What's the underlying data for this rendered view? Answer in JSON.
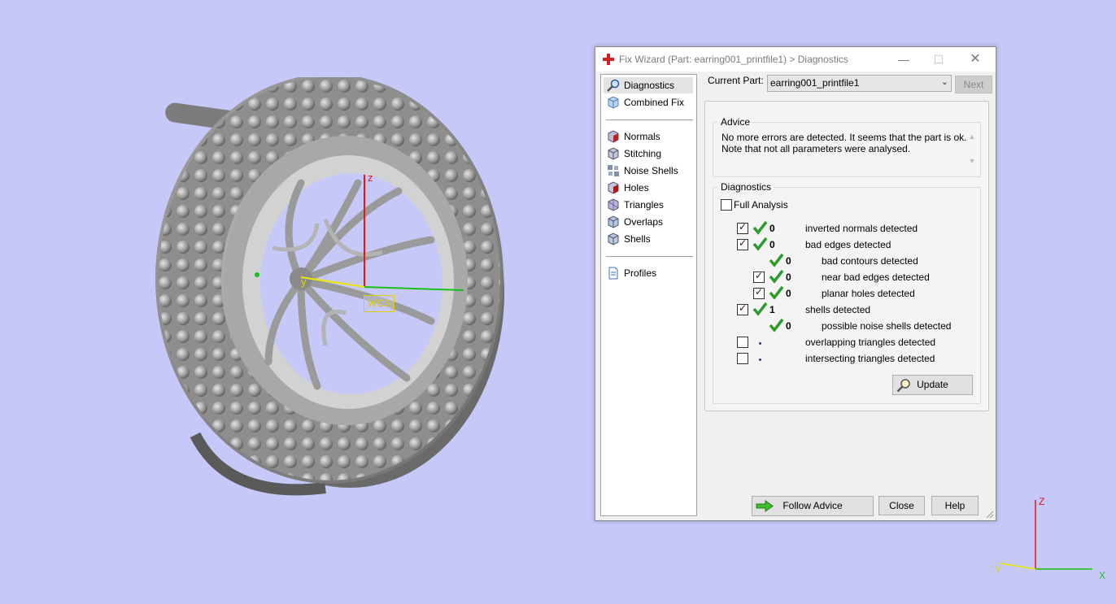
{
  "window": {
    "title": "Fix Wizard (Part: earring001_printfile1) > Diagnostics",
    "minimize": "—",
    "maximize": "☐",
    "close": "✕"
  },
  "sidebar": {
    "items": [
      {
        "label": "Diagnostics",
        "icon": "magnifier-icon",
        "active": true
      },
      {
        "label": "Combined Fix",
        "icon": "cube-icon"
      },
      {
        "label": "Normals",
        "icon": "normals-cube-icon"
      },
      {
        "label": "Stitching",
        "icon": "stitching-cube-icon"
      },
      {
        "label": "Noise Shells",
        "icon": "noise-shells-icon"
      },
      {
        "label": "Holes",
        "icon": "holes-cube-icon"
      },
      {
        "label": "Triangles",
        "icon": "triangles-cube-icon"
      },
      {
        "label": "Overlaps",
        "icon": "overlaps-cube-icon"
      },
      {
        "label": "Shells",
        "icon": "shells-cube-icon"
      },
      {
        "label": "Profiles",
        "icon": "document-icon"
      }
    ]
  },
  "current_part": {
    "label": "Current Part:",
    "value": "earring001_printfile1",
    "next_label": "Next"
  },
  "advice": {
    "title": "Advice",
    "line1": "No more errors are detected. It seems that the part is ok.",
    "line2": "Note that not all parameters were analysed."
  },
  "diagnostics": {
    "title": "Diagnostics",
    "full_analysis_label": "Full Analysis",
    "rows": [
      {
        "checkbox": true,
        "checked": true,
        "status": "ok",
        "count": "0",
        "label": "inverted normals detected",
        "indent": 0
      },
      {
        "checkbox": true,
        "checked": true,
        "status": "ok",
        "count": "0",
        "label": "bad edges detected",
        "indent": 0
      },
      {
        "checkbox": false,
        "checked": false,
        "status": "ok",
        "count": "0",
        "label": "bad contours detected",
        "indent": 1
      },
      {
        "checkbox": true,
        "checked": true,
        "status": "ok",
        "count": "0",
        "label": "near bad edges detected",
        "indent": 1
      },
      {
        "checkbox": true,
        "checked": true,
        "status": "ok",
        "count": "0",
        "label": "planar holes detected",
        "indent": 1
      },
      {
        "checkbox": true,
        "checked": true,
        "status": "ok",
        "count": "1",
        "label": "shells detected",
        "indent": 0
      },
      {
        "checkbox": false,
        "checked": false,
        "status": "ok",
        "count": "0",
        "label": "possible noise shells detected",
        "indent": 1
      },
      {
        "checkbox": true,
        "checked": false,
        "status": "pending",
        "count": "",
        "label": "overlapping triangles detected",
        "indent": 0
      },
      {
        "checkbox": true,
        "checked": false,
        "status": "pending",
        "count": "",
        "label": "intersecting triangles detected",
        "indent": 0
      }
    ],
    "update_label": "Update"
  },
  "footer": {
    "follow_advice_label": "Follow Advice",
    "close_label": "Close",
    "help_label": "Help"
  },
  "viewport": {
    "wcs_label": "WCS",
    "axis_z": "z",
    "axis_y": "y",
    "corner_z": "Z",
    "corner_y": "Y",
    "corner_x": "X",
    "background": "#c6c8f8"
  }
}
